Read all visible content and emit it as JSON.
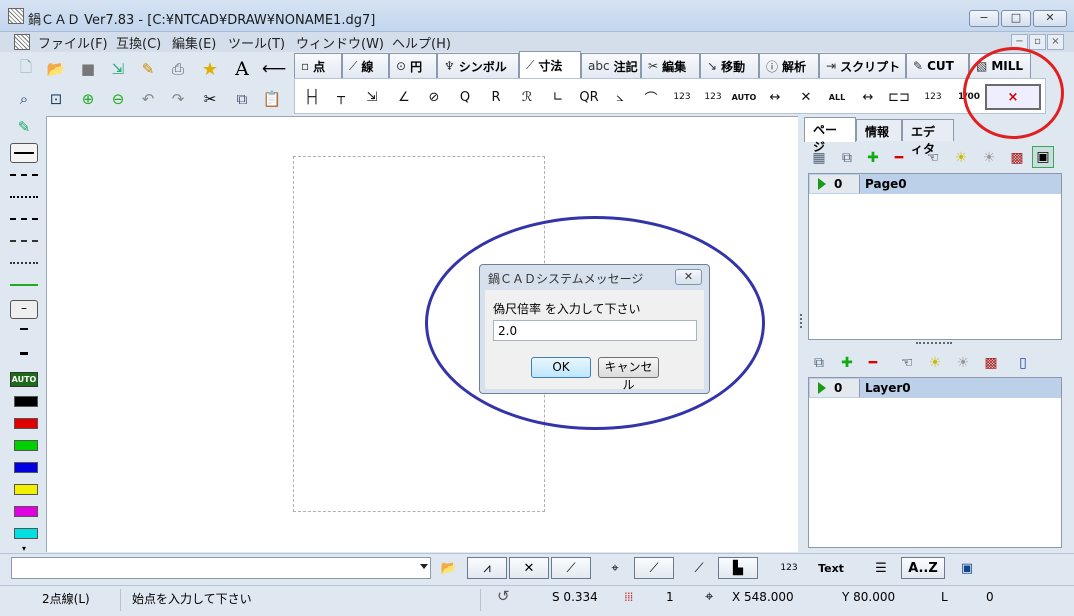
{
  "window": {
    "title": "鍋ＣＡＤ Ver7.83 - [C:¥NTCAD¥DRAW¥NONAME1.dg7]",
    "min_label": "−",
    "max_label": "□",
    "close_label": "✕"
  },
  "menu": [
    "ファイル(F)",
    "互換(C)",
    "編集(E)",
    "ツール(T)",
    "ウィンドウ(W)",
    "ヘルプ(H)"
  ],
  "mdi_buttons": [
    "−",
    "▫",
    "×"
  ],
  "tabs": [
    {
      "icon": "▫",
      "label": "点"
    },
    {
      "icon": "⟋",
      "label": "線"
    },
    {
      "icon": "⊙",
      "label": "円"
    },
    {
      "icon": "♆",
      "label": "シンボル"
    },
    {
      "icon": "⟋",
      "label": "寸法"
    },
    {
      "icon": "abc",
      "label": "注記"
    },
    {
      "icon": "✂",
      "label": "編集"
    },
    {
      "icon": "↘",
      "label": "移動"
    },
    {
      "icon": "ⓘ",
      "label": "解析"
    },
    {
      "icon": "⇥",
      "label": "スクリプト"
    },
    {
      "icon": "✎",
      "label": "CUT"
    },
    {
      "icon": "▧",
      "label": "MILL"
    }
  ],
  "active_tab": "寸法",
  "dim_tools": [
    "├┤",
    "┬",
    "⇲",
    "∠",
    "⊘",
    "Q",
    "R",
    "ℛ",
    "∟",
    "QR",
    "⦣",
    "⌒",
    "123",
    "123",
    "AUTO",
    "↔",
    "✕",
    "ALL",
    "↔",
    "⊏⊐",
    "123",
    "1/00",
    "×"
  ],
  "left_palette": {
    "colors": [
      "#000000",
      "#e00000",
      "#00d000",
      "#0000e0",
      "#f0f000",
      "#e000e0",
      "#00e0e0"
    ],
    "auto_label": "AUTO"
  },
  "right_panel": {
    "tabs": [
      "ページ",
      "情報",
      "エディタ"
    ],
    "page": {
      "index": "0",
      "name": "Page0"
    },
    "layer": {
      "index": "0",
      "name": "Layer0"
    }
  },
  "dialog": {
    "title": "鍋ＣＡＤシステムメッセージ",
    "prompt": "偽尺倍率 を入力して下さい",
    "value": "2.0",
    "ok": "OK",
    "cancel": "キャンセル",
    "close": "✕"
  },
  "bottom_toolbar": {
    "text_label": "Text",
    "sort_label": "A..Z"
  },
  "status": {
    "mode": "2点線(L)",
    "message": "始点を入力して下さい",
    "scale": "S 0.334",
    "grid": "1",
    "x": "X 548.000",
    "y": "Y 80.000",
    "layer_label": "L",
    "layer_value": "0"
  }
}
